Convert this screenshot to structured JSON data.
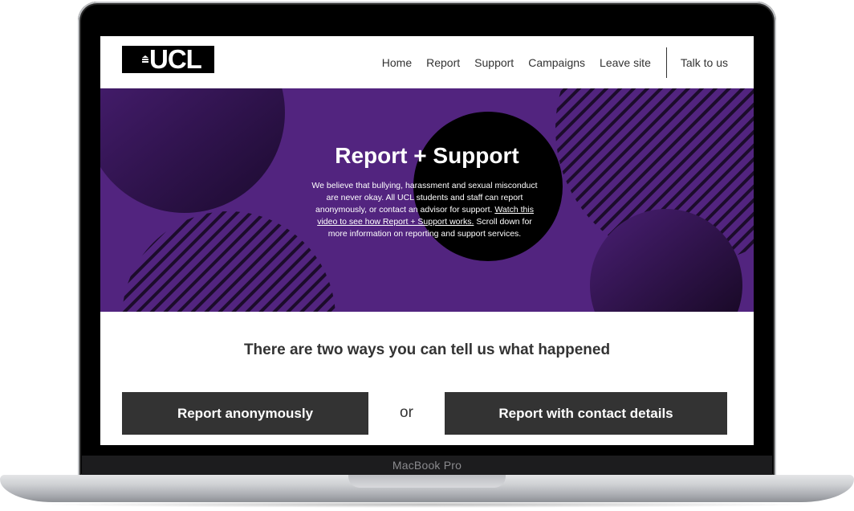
{
  "device": {
    "label": "MacBook Pro"
  },
  "header": {
    "logo_text": "UCL",
    "nav": {
      "home": "Home",
      "report": "Report",
      "support": "Support",
      "campaigns": "Campaigns",
      "leave_site": "Leave site",
      "talk": "Talk to us"
    }
  },
  "hero": {
    "title": "Report + Support",
    "text_before": "We believe that bullying, harassment and sexual misconduct are never okay. All UCL students and staff can report anonymously, or contact an advisor for support. ",
    "link_text": "Watch this video to see how Report + Support works.",
    "text_after": " Scroll down for more information on reporting and support services."
  },
  "ways": {
    "heading": "There are two ways you can tell us what happened",
    "anon_label": "Report anonymously",
    "or_label": "or",
    "contact_label": "Report with contact details"
  },
  "colors": {
    "hero_purple": "#52247f",
    "button_dark": "#333333"
  }
}
